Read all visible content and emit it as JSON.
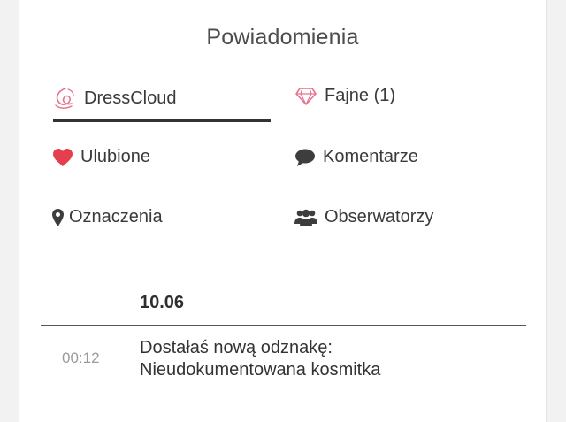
{
  "page": {
    "title": "Powiadomienia"
  },
  "tabs": [
    {
      "label": "DressCloud",
      "icon": "dresscloud-logo-icon",
      "active": true
    },
    {
      "label": "Fajne (1)",
      "icon": "diamond-icon",
      "active": false
    },
    {
      "label": "Ulubione",
      "icon": "heart-icon",
      "active": false
    },
    {
      "label": "Komentarze",
      "icon": "comment-icon",
      "active": false
    },
    {
      "label": "Oznaczenia",
      "icon": "map-marker-icon",
      "active": false
    },
    {
      "label": "Obserwatorzy",
      "icon": "users-icon",
      "active": false
    }
  ],
  "notifications": {
    "date": "10.06",
    "items": [
      {
        "time": "00:12",
        "line1": "Dostałaś nową odznakę:",
        "line2": "Nieudokumentowana kosmitka"
      }
    ]
  },
  "colors": {
    "accent_pink": "#e8738f",
    "heart_red": "#e53e4f",
    "text_dark": "#333333",
    "time_gray": "#9a9a9a"
  }
}
